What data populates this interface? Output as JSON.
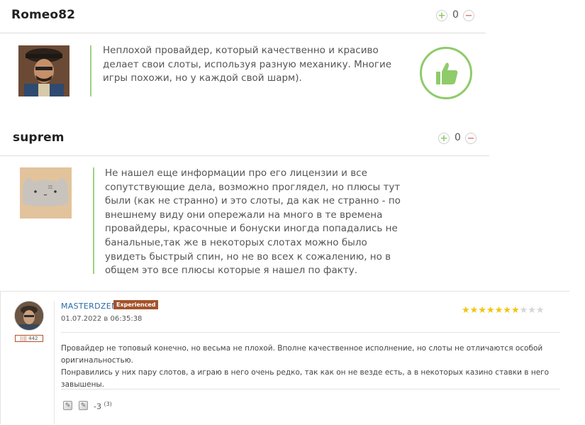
{
  "comments": [
    {
      "username": "Romeo82",
      "vote_count": "0",
      "plus_glyph": "+",
      "minus_glyph": "−",
      "avatar_icon": "user-avatar-photo",
      "text": "Неплохой провайдер, который качественно и красиво делает свои слоты, используя разную механику. Многие игры похожи, но у каждой свой шарм).",
      "badge_icon": "thumbs-up-icon"
    },
    {
      "username": "suprem",
      "vote_count": "0",
      "plus_glyph": "+",
      "minus_glyph": "−",
      "avatar_icon": "cat-avatar",
      "text": "Не нашел еще информации про его лицензии и все сопутствующие дела, возможно проглядел, но плюсы тут были (как не странно) и это слоты, да как не странно - по внешнему виду они опережали на много в те времена провайдеры, красочные и бонуски иногда попадались не банальные,так же в некоторых слотах можно было увидеть быстрый спин, но не во всех к сожалению, но в общем это все плюсы которые я нашел по факту."
    }
  ],
  "post": {
    "username": "MASTERDZEN",
    "rank_badge": "Experienced",
    "user_count": "442",
    "date": "01.07.2022 в 06:35:38",
    "rating": 7,
    "rating_max": 10,
    "paragraph1": "Провайдер не топовый конечно, но весьма не плохой. Вполне качественное исполнение, но слоты не отличаются особой оригинальностью.",
    "paragraph2": "Понравились у них пару слотов, а играю в него очень редко, так как он не везде есть, а в некоторых казино ставки в него завышены.",
    "score": "-3",
    "score_votes": "(3)"
  },
  "colors": {
    "accent_green": "#8fcb6a",
    "link_blue": "#2a6aa8",
    "badge_brown": "#a4522a",
    "star_gold": "#f1c40f"
  }
}
